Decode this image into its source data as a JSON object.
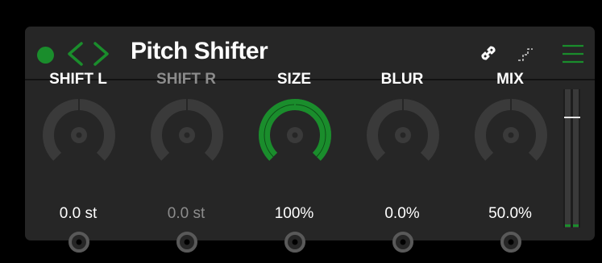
{
  "header": {
    "title": "Pitch Shifter",
    "colors": {
      "accent": "#1a8d2c",
      "panel": "#262626",
      "text": "#ffffff",
      "dim_text": "#8c8c8c"
    },
    "icons": [
      "power-icon",
      "chevron-left-icon",
      "chevron-right-icon",
      "link-icon",
      "step-icon",
      "menu-icon"
    ]
  },
  "knobs": [
    {
      "label": "SHIFT L",
      "value": "0.0 st",
      "level": 0.5,
      "enabled": true
    },
    {
      "label": "SHIFT R",
      "value": "0.0 st",
      "level": 0.5,
      "enabled": false
    },
    {
      "label": "SIZE",
      "value": "100%",
      "level": 1.0,
      "enabled": true
    },
    {
      "label": "BLUR",
      "value": "0.0%",
      "level": 0.0,
      "enabled": true
    },
    {
      "label": "MIX",
      "value": "50.0%",
      "level": 0.5,
      "enabled": true
    }
  ],
  "meter": {
    "level": 0.2
  }
}
